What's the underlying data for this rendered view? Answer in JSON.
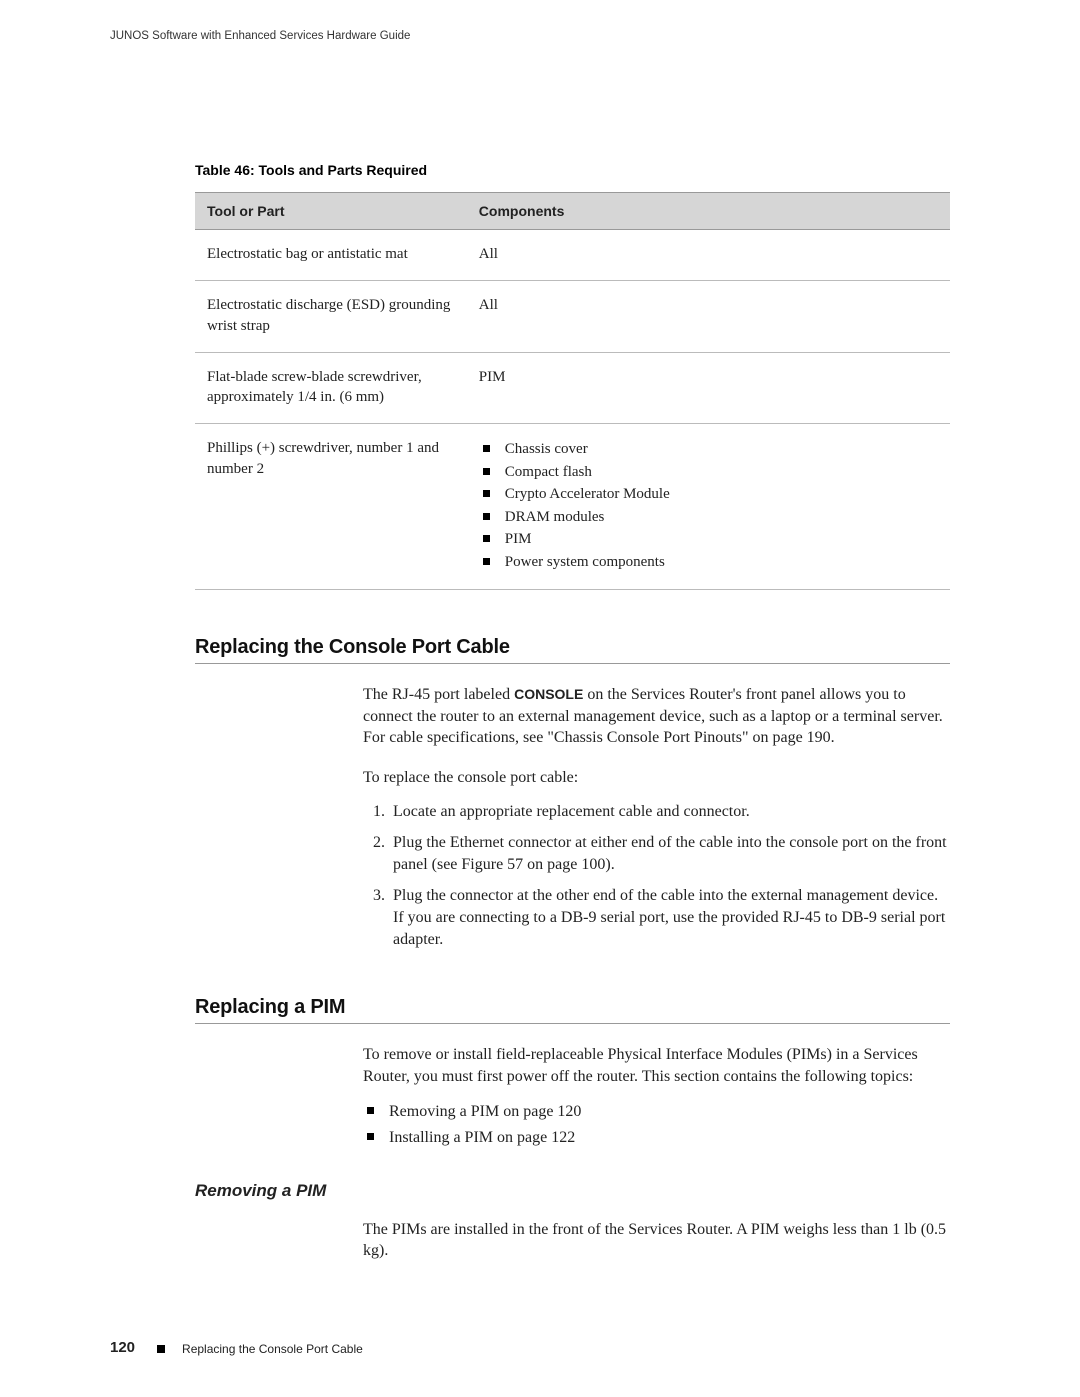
{
  "header": {
    "running_title": "JUNOS Software with Enhanced Services Hardware Guide"
  },
  "table": {
    "caption": "Table 46: Tools and Parts Required",
    "head": {
      "col1": "Tool or Part",
      "col2": "Components"
    },
    "rows": [
      {
        "tool": "Electrostatic bag or antistatic mat",
        "comp": "All"
      },
      {
        "tool": "Electrostatic discharge (ESD) grounding wrist strap",
        "comp": "All"
      },
      {
        "tool": "Flat-blade screw-blade screwdriver, approximately 1/4 in. (6 mm)",
        "comp": "PIM"
      },
      {
        "tool": "Phillips (+) screwdriver, number 1 and number 2",
        "list": [
          "Chassis cover",
          "Compact flash",
          "Crypto Accelerator Module",
          "DRAM modules",
          "PIM",
          "Power system components"
        ]
      }
    ]
  },
  "section1": {
    "heading": "Replacing the Console Port Cable",
    "p1a": "The RJ-45 port labeled ",
    "p1b": "CONSOLE",
    "p1c": " on the Services Router's front panel allows you to connect the router to an external management device, such as a laptop or a terminal server. For cable specifications, see \"Chassis Console Port Pinouts\" on page 190.",
    "p2": "To replace the console port cable:",
    "steps": [
      "Locate an appropriate replacement cable and connector.",
      "Plug the Ethernet connector at either end of the cable into the console port on the front panel (see Figure 57 on page 100).",
      "Plug the connector at the other end of the cable into the external management device. If you are connecting to a DB-9 serial port, use the provided RJ-45 to DB-9 serial port adapter."
    ]
  },
  "section2": {
    "heading": "Replacing a PIM",
    "p1": "To remove or install field-replaceable Physical Interface Modules (PIMs) in a Services Router, you must first power off the router. This section contains the following topics:",
    "bullets": [
      "Removing a PIM on page 120",
      "Installing a PIM on page 122"
    ],
    "sub_heading": "Removing a PIM",
    "sub_p": "The PIMs are installed in the front of the Services Router. A PIM weighs less than 1 lb (0.5 kg)."
  },
  "footer": {
    "page_number": "120",
    "text": "Replacing the Console Port Cable"
  }
}
